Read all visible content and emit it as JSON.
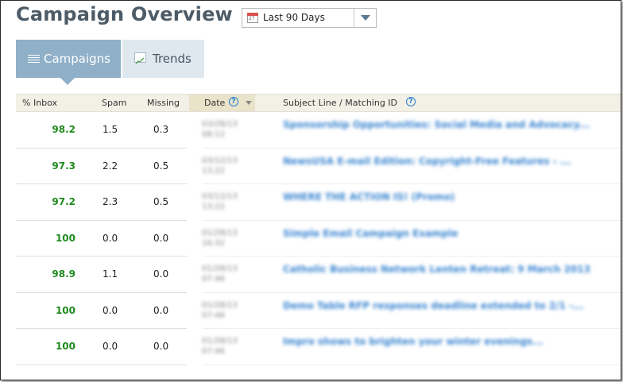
{
  "page": {
    "title": "Campaign Overview"
  },
  "date_range": {
    "selected": "Last 90 Days",
    "calendar_day": "27"
  },
  "tabs": [
    {
      "label": "Campaigns",
      "icon": "list-lines-icon",
      "active": true
    },
    {
      "label": "Trends",
      "icon": "trend-chart-icon",
      "active": false
    }
  ],
  "table": {
    "headers": {
      "inbox": "% Inbox",
      "spam": "Spam",
      "missing": "Missing",
      "date": "Date",
      "subject": "Subject Line / Matching ID"
    },
    "help_glyph": "?",
    "rows": [
      {
        "inbox": "98.2",
        "spam": "1.5",
        "missing": "0.3",
        "date": "03/28/13",
        "time": "08:12",
        "subject": "Sponsorship Opportunities: Social Media and Advocacy..."
      },
      {
        "inbox": "97.3",
        "spam": "2.2",
        "missing": "0.5",
        "date": "03/12/13",
        "time": "13:22",
        "subject": "NewsUSA E-mail Edition: Copyright-Free Features - ..."
      },
      {
        "inbox": "97.2",
        "spam": "2.3",
        "missing": "0.5",
        "date": "03/12/13",
        "time": "13:22",
        "subject": "WHERE THE ACTION IS! (Promo)"
      },
      {
        "inbox": "100",
        "spam": "0.0",
        "missing": "0.0",
        "date": "01/28/13",
        "time": "16:32",
        "subject": "Simple Email Campaign Example"
      },
      {
        "inbox": "98.9",
        "spam": "1.1",
        "missing": "0.0",
        "date": "01/28/13",
        "time": "07:46",
        "subject": "Catholic Business Network Lenten Retreat: 9 March 2013"
      },
      {
        "inbox": "100",
        "spam": "0.0",
        "missing": "0.0",
        "date": "01/28/13",
        "time": "07:46",
        "subject": "Demo Table RFP responses deadline extended to 2/1 -..."
      },
      {
        "inbox": "100",
        "spam": "0.0",
        "missing": "0.0",
        "date": "01/28/13",
        "time": "07:46",
        "subject": "Impro shows to brighten your winter evenings..."
      }
    ]
  },
  "colors": {
    "title": "#4d5b67",
    "tab_active": "#8fb0c8",
    "tab_inactive": "#dfe8ef",
    "inbox_green": "#1f8a1f",
    "link_blue": "#3b86d1",
    "header_bg": "#f3f1e6"
  }
}
